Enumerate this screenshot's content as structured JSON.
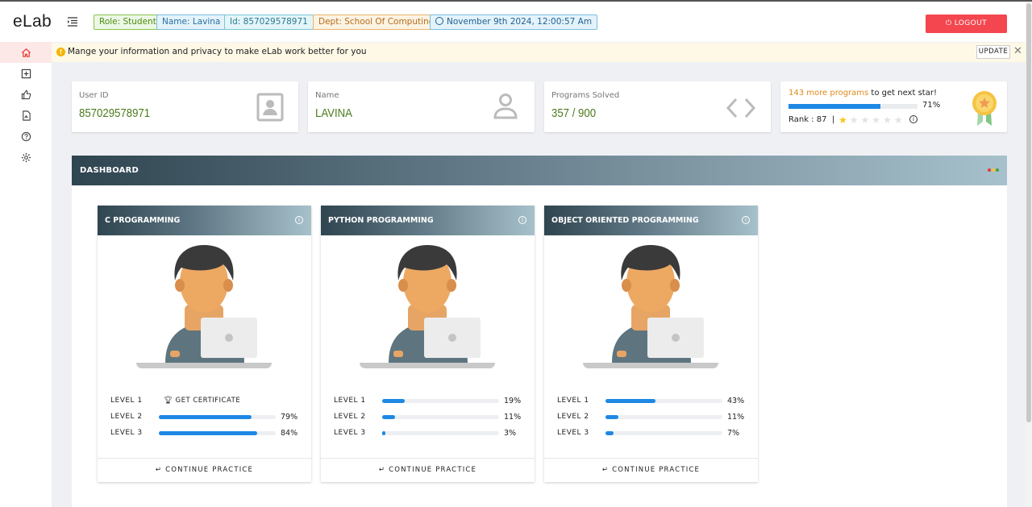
{
  "app": {
    "logo": "eLab"
  },
  "chips": {
    "role": "Role: Student",
    "name": "Name: Lavina",
    "id": "Id: 857029578971",
    "dept": "Dept: School Of Computing",
    "datetime": "November 9th 2024, 12:00:57 Am"
  },
  "logout_label": "LOGOUT",
  "notice": {
    "text": "Mange your information and privacy to make eLab work better for you",
    "update_label": "UPDATE"
  },
  "sidebar": {
    "items": [
      {
        "icon": "home-icon",
        "active": true
      },
      {
        "icon": "add-box-icon"
      },
      {
        "icon": "thumbs-up-icon"
      },
      {
        "icon": "report-icon"
      },
      {
        "icon": "help-icon"
      },
      {
        "icon": "settings-icon"
      }
    ]
  },
  "cards": {
    "user_id": {
      "label": "User ID",
      "value": "857029578971",
      "icon": "id-card-icon"
    },
    "name": {
      "label": "Name",
      "value": "LAVINA",
      "icon": "user-icon"
    },
    "programs": {
      "label": "Programs Solved",
      "value": "357 / 900",
      "icon": "code-icon"
    },
    "star": {
      "highlight": "143 more programs",
      "rest": " to get next star!",
      "progress_pct": 71,
      "progress_text": "71%",
      "rank_label": "Rank : ",
      "rank_value": "87",
      "separator": "|",
      "stars_filled": 1,
      "stars_total": 6,
      "icon": "medal-icon"
    }
  },
  "dashboard": {
    "title": "DASHBOARD",
    "courses": [
      {
        "title": "C PROGRAMMING",
        "levels": [
          {
            "label": "LEVEL 1",
            "certificate": "GET CERTIFICATE"
          },
          {
            "label": "LEVEL 2",
            "percent": 79,
            "text": "79%"
          },
          {
            "label": "LEVEL 3",
            "percent": 84,
            "text": "84%"
          }
        ],
        "footer": "CONTINUE PRACTICE"
      },
      {
        "title": "PYTHON PROGRAMMING",
        "levels": [
          {
            "label": "LEVEL 1",
            "percent": 19,
            "text": "19%"
          },
          {
            "label": "LEVEL 2",
            "percent": 11,
            "text": "11%"
          },
          {
            "label": "LEVEL 3",
            "percent": 3,
            "text": "3%"
          }
        ],
        "footer": "CONTINUE PRACTICE"
      },
      {
        "title": "OBJECT ORIENTED PROGRAMMING",
        "levels": [
          {
            "label": "LEVEL 1",
            "percent": 43,
            "text": "43%"
          },
          {
            "label": "LEVEL 2",
            "percent": 11,
            "text": "11%"
          },
          {
            "label": "LEVEL 3",
            "percent": 7,
            "text": "7%"
          }
        ],
        "footer": "CONTINUE PRACTICE"
      }
    ]
  },
  "colors": {
    "logout": "#f4464f",
    "accent_blue": "#1e88e5",
    "value_green": "#4b7c1c",
    "star_gold": "#f5c518"
  }
}
